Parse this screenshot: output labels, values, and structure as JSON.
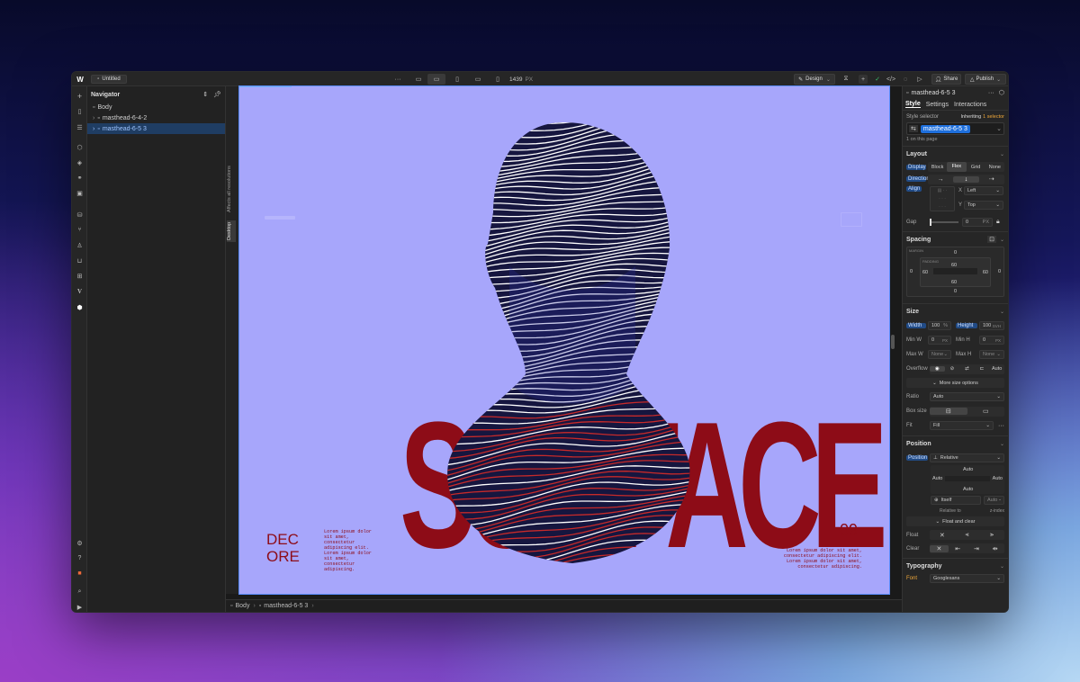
{
  "topbar": {
    "doc_title": "Untitled",
    "canvas_width": "1439",
    "unit": "PX",
    "mode": "Design",
    "share": "Share",
    "publish": "Publish"
  },
  "navigator": {
    "title": "Navigator",
    "items": [
      "Body",
      "masthead-6-4-2",
      "masthead-6-5 3"
    ]
  },
  "canvas": {
    "side_labels": [
      "Desktop",
      "Affects all resolutions"
    ],
    "hero": {
      "big_text": "SURFACE",
      "decor_line1": "DEC",
      "decor_line2": "ORE",
      "number": "09",
      "left_lines": [
        "Lorem ipsum dolor",
        "sit amet,",
        "consectetur",
        "adipiscing elit.",
        "Lorem ipsum dolor",
        "sit amet,",
        "consectetur",
        "adipiscing."
      ],
      "right_lines": [
        "Lorem ipsum dolor sit amet,",
        "consectetur adipiscing elit.",
        "Lorem ipsum dolor sit amet,",
        "consectetur adipiscing."
      ],
      "bg": "#a7a6fb",
      "text_color": "#8d0c17"
    },
    "breadcrumb": [
      "Body",
      "masthead-6-5 3"
    ]
  },
  "panel": {
    "element": "masthead-6-5 3",
    "tabs": [
      "Style",
      "Settings",
      "Interactions"
    ],
    "style_selector": "Style selector",
    "inheriting": "Inheriting",
    "selector_count": "1 selector",
    "selector_value": "masthead-6-5 3",
    "on_page": "1 on this page",
    "layout": {
      "title": "Layout",
      "display_label": "Display",
      "display_opts": [
        "Block",
        "Flex",
        "Grid",
        "None"
      ],
      "direction_label": "Direction",
      "align_label": "Align",
      "x_label": "X",
      "x_value": "Left",
      "y_label": "Y",
      "y_value": "Top",
      "gap_label": "Gap",
      "gap_value": "0",
      "gap_unit": "PX"
    },
    "spacing": {
      "title": "Spacing",
      "margin_label": "MARGIN",
      "padding_label": "PADDING",
      "margin": [
        "0",
        "0",
        "0",
        "0"
      ],
      "padding": [
        "60",
        "60",
        "60",
        "60"
      ]
    },
    "size": {
      "title": "Size",
      "width_label": "Width",
      "width": "100",
      "width_unit": "%",
      "height_label": "Height",
      "height": "100",
      "height_unit": "SVH",
      "minw_label": "Min W",
      "minw": "0",
      "minw_unit": "PX",
      "minh_label": "Min H",
      "minh": "0",
      "minh_unit": "PX",
      "maxw_label": "Max W",
      "maxw": "None",
      "maxh_label": "Max H",
      "maxh": "None",
      "overflow_label": "Overflow",
      "overflow_auto": "Auto",
      "more": "More size options",
      "ratio_label": "Ratio",
      "ratio": "Auto",
      "boxsize_label": "Box size",
      "fit_label": "Fit",
      "fit": "Fill"
    },
    "position": {
      "title": "Position",
      "pos_label": "Position",
      "pos_value": "Relative",
      "auto": "Auto",
      "itself": "Itself",
      "relative_to": "Relative to",
      "z_auto": "Auto",
      "z_label": "z-index",
      "float_clear": "Float and clear",
      "float_label": "Float",
      "clear_label": "Clear"
    },
    "typography": {
      "title": "Typography",
      "font_label": "Font",
      "font_value": "Googlesans"
    }
  }
}
